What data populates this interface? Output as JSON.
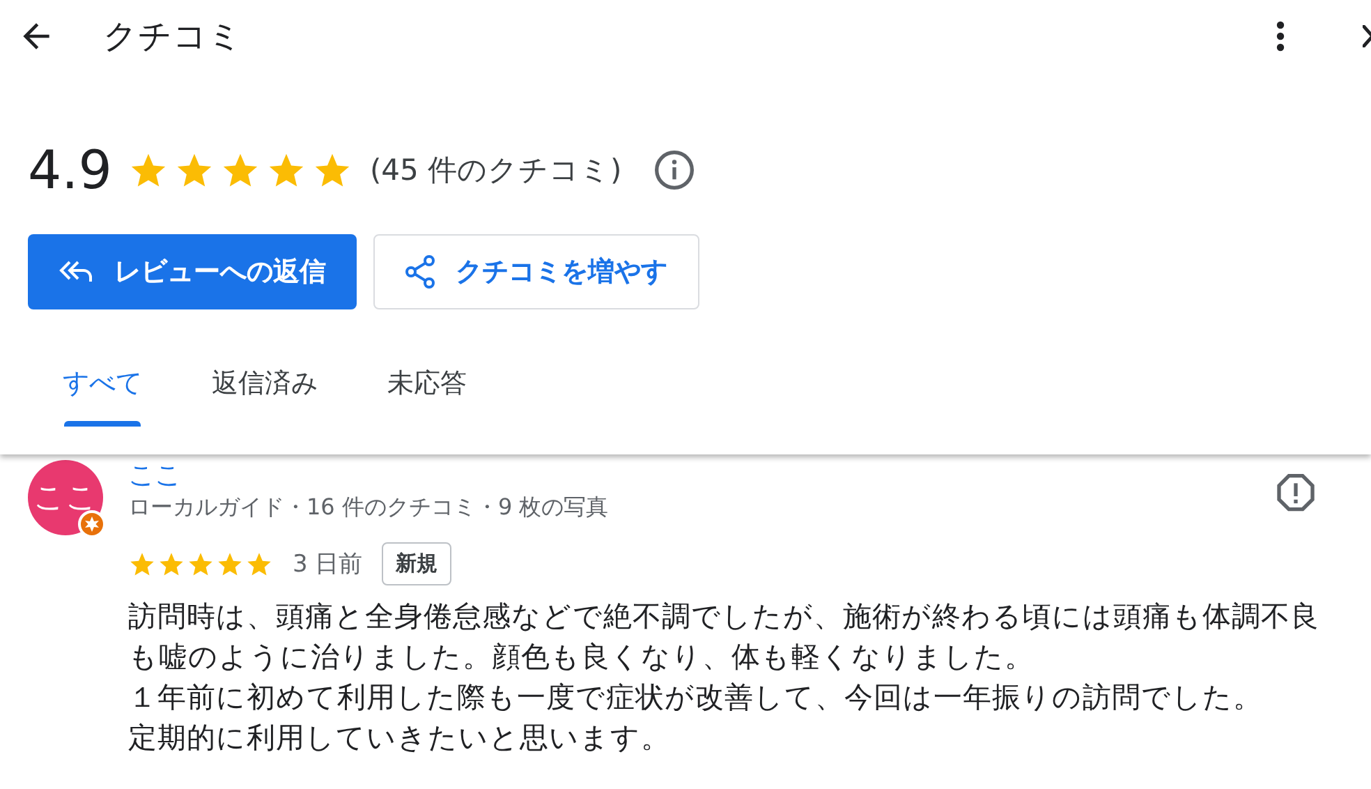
{
  "header": {
    "title": "クチコミ"
  },
  "summary": {
    "rating": "4.9",
    "stars": 5,
    "count": "(45 件のクチコミ)"
  },
  "actions": [
    {
      "kind": "primary",
      "label": "レビューへの返信"
    },
    {
      "kind": "secondary",
      "label": "クチコミを増やす"
    }
  ],
  "tabs": [
    {
      "label": "すべて",
      "selected": true
    },
    {
      "label": "返信済み",
      "selected": false
    },
    {
      "label": "未応答",
      "selected": false
    }
  ],
  "reviews": [
    {
      "avatar": "ここ",
      "name": "ここ",
      "meta": "ローカルガイド・16 件のクチコミ・9 枚の写真",
      "stars": 5,
      "time": "3 日前",
      "badge": "新規",
      "paragraphs": [
        "訪問時は、頭痛と全身倦怠感などで絶不調でしたが、施術が終わる頃には頭痛も体調不良も嘘のように治りました。顔色も良くなり、体も軽くなりました。",
        "１年前に初めて利用した際も一度で症状が改善して、今回は一年振りの訪問でした。",
        "定期的に利用していきたいと思います。"
      ]
    }
  ]
}
